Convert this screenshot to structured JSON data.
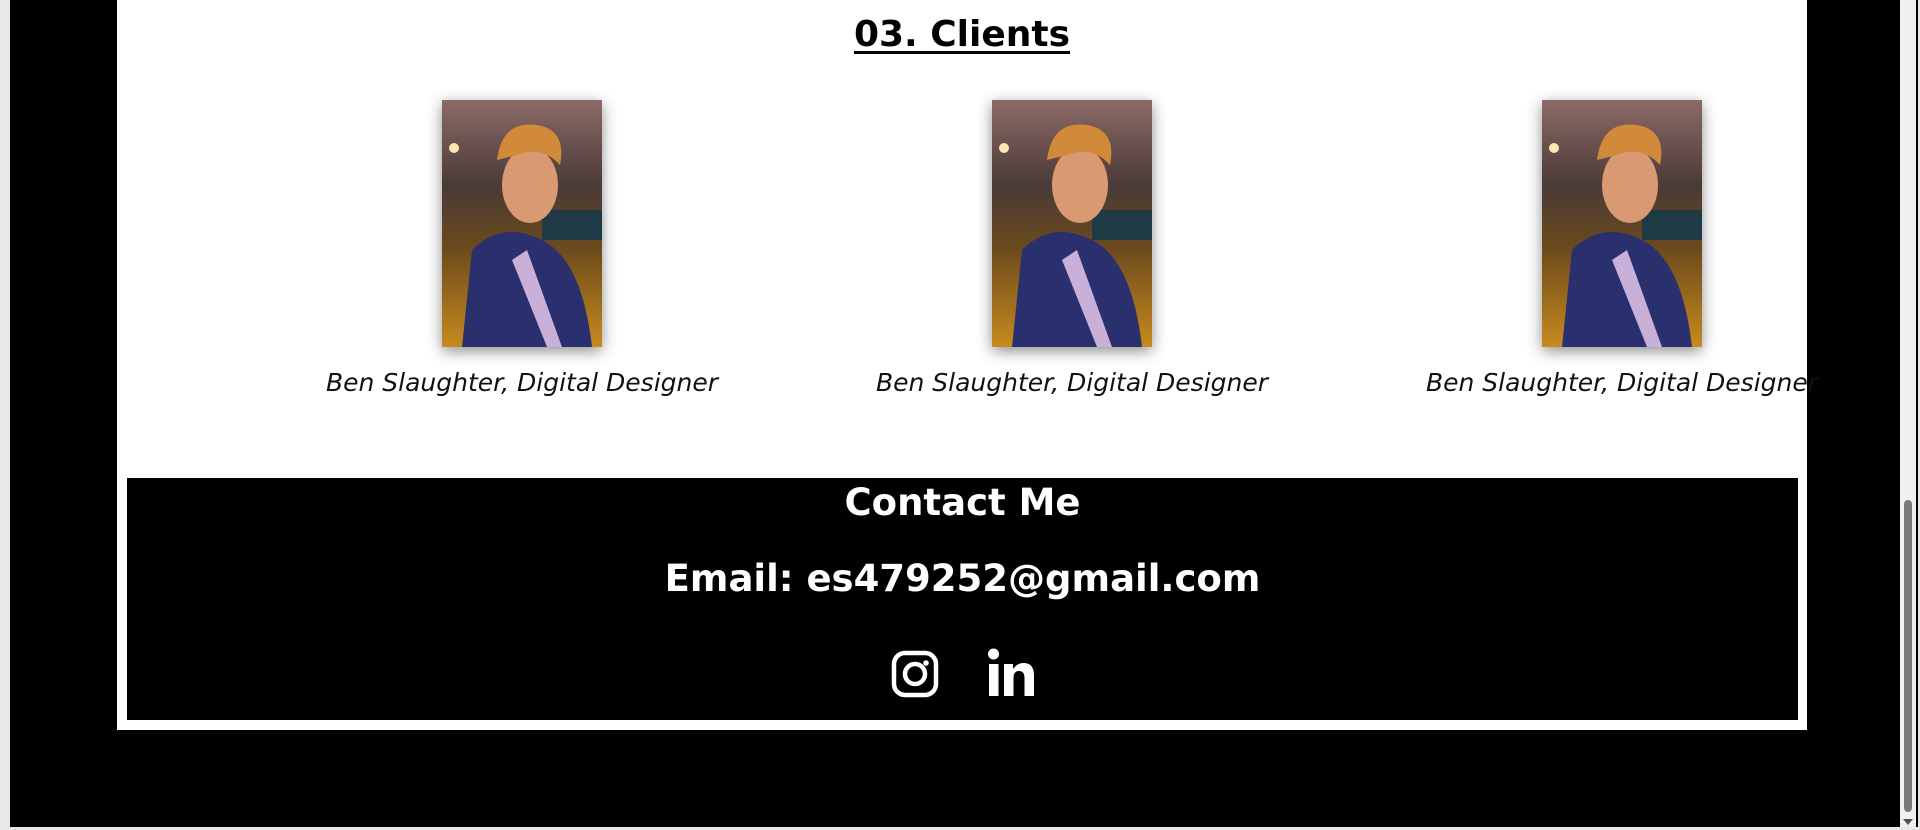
{
  "clients": {
    "title": "03. Clients",
    "items": [
      {
        "caption": "Ben Slaughter, Digital Designer"
      },
      {
        "caption": "Ben Slaughter, Digital Designer"
      },
      {
        "caption": "Ben Slaughter, Digital Designer"
      }
    ]
  },
  "contact": {
    "title": "Contact Me",
    "email": "Email: es479252@gmail.com",
    "socials": [
      {
        "icon": "instagram-icon"
      },
      {
        "icon": "linkedin-icon"
      }
    ]
  },
  "colors": {
    "background": "#000000",
    "card": "#ffffff",
    "contact_bg": "#000000",
    "contact_text": "#ffffff"
  }
}
